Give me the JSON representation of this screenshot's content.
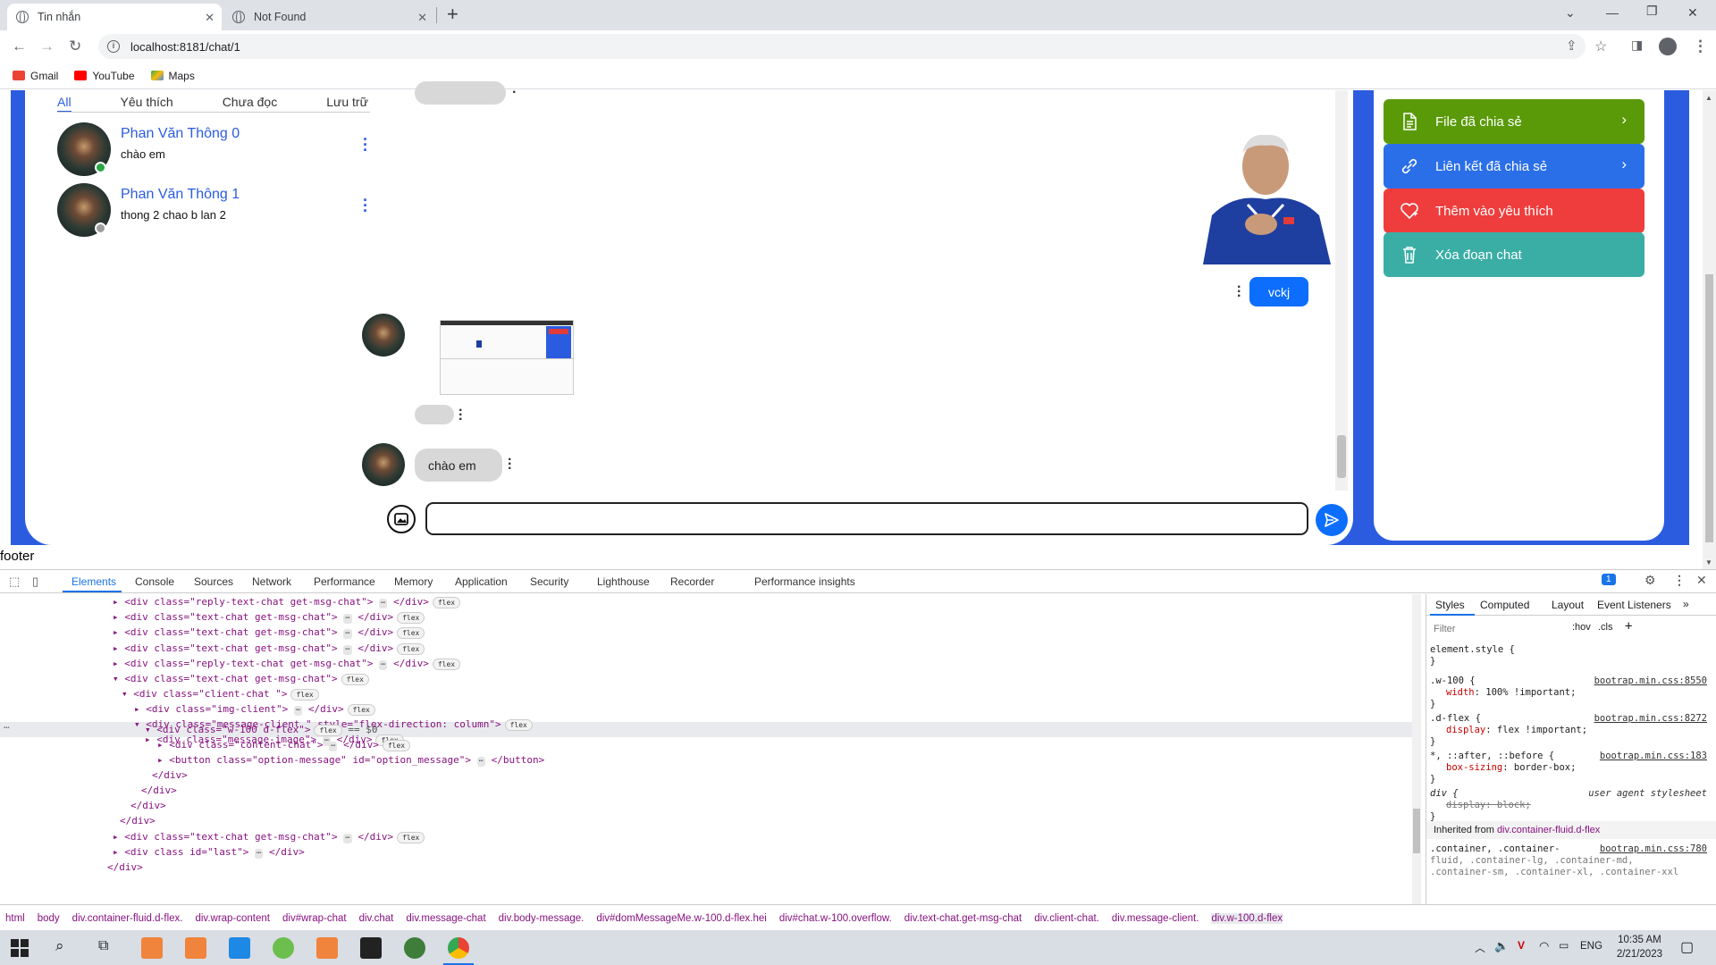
{
  "browser": {
    "tabs": [
      {
        "title": "Tin nhắn",
        "active": true
      },
      {
        "title": "Not Found",
        "active": false
      }
    ],
    "new_tab": "+",
    "url": "localhost:8181/chat/1",
    "bookmarks": [
      "Gmail",
      "YouTube",
      "Maps"
    ]
  },
  "sidebar": {
    "filters": [
      "All",
      "Yêu thích",
      "Chưa đọc",
      "Lưu trữ"
    ],
    "conversations": [
      {
        "name": "Phan Văn Thông 0",
        "last_message": "chào em",
        "status_color": "#28a745"
      },
      {
        "name": "Phan Văn Thông 1",
        "last_message": "thong 2 chao b lan 2",
        "status_color": "#9e9e9e"
      }
    ]
  },
  "chat": {
    "messages": [
      {
        "from": "me",
        "text": "vckj"
      },
      {
        "from": "client",
        "text": "chào em"
      }
    ],
    "colors": {
      "me_bubble": "#0d6efd",
      "client_bubble": "#d8d8d8"
    }
  },
  "actions": [
    {
      "label": "File đã chia sẻ",
      "color": "#5a9a08",
      "icon": "file-icon",
      "chevron": true
    },
    {
      "label": "Liên kết đã chia sẻ",
      "color": "#2b6fe8",
      "icon": "link-icon",
      "chevron": true
    },
    {
      "label": "Thêm vào yêu thích",
      "color": "#ef3d3d",
      "icon": "heart-icon",
      "chevron": false
    },
    {
      "label": "Xóa đoạn chat",
      "color": "#3aaea5",
      "icon": "trash-icon",
      "chevron": false
    }
  ],
  "footer": "footer",
  "devtools": {
    "tabs": [
      "Elements",
      "Console",
      "Sources",
      "Network",
      "Performance",
      "Memory",
      "Application",
      "Security",
      "Lighthouse",
      "Recorder",
      "Performance insights"
    ],
    "issues_count": "1",
    "dom_lines": [
      "<div class=\"reply-text-chat get-msg-chat\">",
      "<div class=\"text-chat get-msg-chat\">",
      "<div class=\"text-chat get-msg-chat\">",
      "<div class=\"text-chat get-msg-chat\">",
      "<div class=\"reply-text-chat get-msg-chat\">",
      "<div class=\"text-chat get-msg-chat\">",
      "<div class=\"client-chat \">",
      "<div class=\"img-client\">",
      "<div class=\"message-client \" style=\"flex-direction: column\">",
      "<div class=\"message-image\">",
      "<div class=\"w-100 d-flex\">",
      "<div class=\"content-chat\">",
      "<button class=\"option-message\" id=\"option_message\">",
      "</div>",
      "</div>",
      "</div>",
      "<div class=\"text-chat get-msg-chat\">",
      "<div class id=\"last\">",
      "</div>"
    ],
    "selected_suffix": "== $0",
    "styles_tabs": [
      "Styles",
      "Computed",
      "Layout",
      "Event Listeners"
    ],
    "filter_placeholder": "Filter",
    "hov": ":hov",
    "cls": ".cls",
    "styles": {
      "element_style": "element.style {",
      "rule1_selector": ".w-100 {",
      "rule1_prop": "width",
      "rule1_value": "100% !important;",
      "rule1_src": "bootrap.min.css:8550",
      "rule2_selector": ".d-flex {",
      "rule2_prop": "display",
      "rule2_value": "flex !important;",
      "rule2_src": "bootrap.min.css:8272",
      "rule3_selector": "*, ::after, ::before {",
      "rule3_prop": "box-sizing",
      "rule3_value": "border-box;",
      "rule3_src": "bootrap.min.css:183",
      "rule4_selector": "div {",
      "rule4_src": "user agent stylesheet",
      "rule4_prop": "display: block;",
      "inherited_label": "Inherited from",
      "inherited_from": "div.container-fluid.d-flex",
      "rule5_selector": ".container, .container-",
      "rule5_src": "bootrap.min.css:780",
      "rule5_line2": "fluid, .container-lg, .container-md,",
      "rule5_line3": ".container-sm, .container-xl, .container-xxl"
    },
    "breadcrumb": [
      "html",
      "body",
      "div.container-fluid.d-flex.",
      "div.wrap-content",
      "div#wrap-chat",
      "div.chat",
      "div.message-chat",
      "div.body-message.",
      "div#domMessageMe.w-100.d-flex.hei",
      "div#chat.w-100.overflow.",
      "div.text-chat.get-msg-chat",
      "div.client-chat.",
      "div.message-client.",
      "div.w-100.d-flex"
    ]
  },
  "taskbar": {
    "language": "ENG",
    "time": "10:35 AM",
    "date": "2/21/2023"
  }
}
